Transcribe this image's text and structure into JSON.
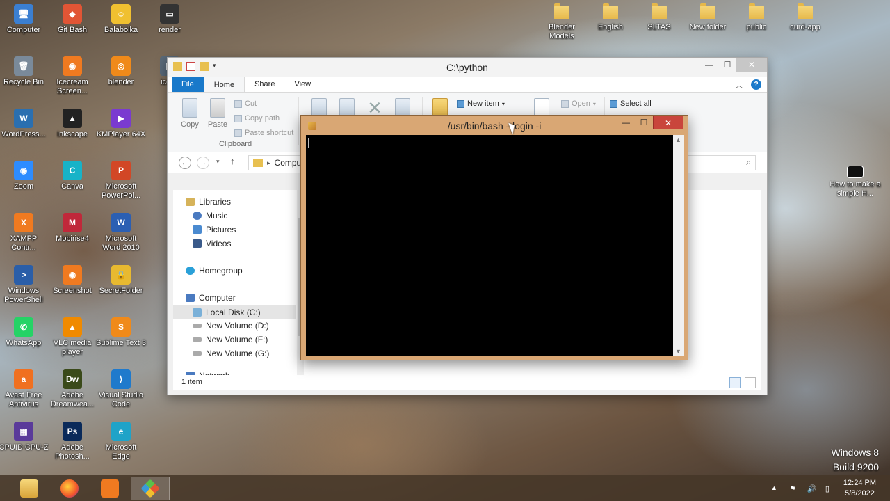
{
  "desktop": {
    "left_icons": [
      {
        "label": "Computer",
        "color": "#3b7fd1",
        "glyph": "🖥"
      },
      {
        "label": "Git Bash",
        "color": "#e15535",
        "glyph": "◆"
      },
      {
        "label": "Balabolka",
        "color": "#f0c030",
        "glyph": "☺"
      },
      {
        "label": "render",
        "color": "#333333",
        "glyph": "▭"
      },
      {
        "label": "Recycle Bin",
        "color": "#7a8a9a",
        "glyph": "🗑"
      },
      {
        "label": "Icecream Screen...",
        "color": "#f07a20",
        "glyph": "◉"
      },
      {
        "label": "blender",
        "color": "#f08a1a",
        "glyph": "◎"
      },
      {
        "label": "ice_v",
        "color": "#5a6a7a",
        "glyph": "▦"
      },
      {
        "label": "WordPress...",
        "color": "#2a6fb0",
        "glyph": "W"
      },
      {
        "label": "Inkscape",
        "color": "#222222",
        "glyph": "▲"
      },
      {
        "label": "KMPlayer 64X",
        "color": "#7a3ad0",
        "glyph": "▶"
      },
      {
        "label": "Zoom",
        "color": "#2d8cff",
        "glyph": "◉"
      },
      {
        "label": "Canva",
        "color": "#17b3c8",
        "glyph": "C"
      },
      {
        "label": "Microsoft PowerPoi...",
        "color": "#d24726",
        "glyph": "P"
      },
      {
        "label": "XAMPP Contr...",
        "color": "#f07a20",
        "glyph": "X"
      },
      {
        "label": "Mobirise4",
        "color": "#c0283a",
        "glyph": "M"
      },
      {
        "label": "Microsoft Word 2010",
        "color": "#2b5fb3",
        "glyph": "W"
      },
      {
        "label": "Windows PowerShell",
        "color": "#2a5ea8",
        "glyph": ">"
      },
      {
        "label": "Screenshot",
        "color": "#f07a20",
        "glyph": "◉"
      },
      {
        "label": "SecretFolder",
        "color": "#e8b930",
        "glyph": "🔒"
      },
      {
        "label": "WhatsApp",
        "color": "#25d366",
        "glyph": "✆"
      },
      {
        "label": "VLC media player",
        "color": "#f08a00",
        "glyph": "▲"
      },
      {
        "label": "Sublime Text 3",
        "color": "#f08a1a",
        "glyph": "S"
      },
      {
        "label": "Avast Free Antivirus",
        "color": "#f07020",
        "glyph": "a"
      },
      {
        "label": "Adobe Dreamwea...",
        "color": "#3a4a1a",
        "glyph": "Dw"
      },
      {
        "label": "Visual Studio Code",
        "color": "#1f7acc",
        "glyph": "⟩"
      },
      {
        "label": "CPUID CPU-Z",
        "color": "#5a3a9a",
        "glyph": "▦"
      },
      {
        "label": "Adobe Photosh...",
        "color": "#0a2a5a",
        "glyph": "Ps"
      },
      {
        "label": "Microsoft Edge",
        "color": "#1fa3c8",
        "glyph": "e"
      }
    ],
    "top_folders": [
      "Blender Models",
      "English",
      "SLTAS",
      "New folder",
      "public",
      "curd-app"
    ],
    "right_shortcut": {
      "label": "How to make a simple H..."
    },
    "watermark": {
      "line1": "Windows 8",
      "line2": "Build 9200"
    }
  },
  "explorer": {
    "title": "C:\\python",
    "tabs": {
      "file": "File",
      "home": "Home",
      "share": "Share",
      "view": "View"
    },
    "ribbon": {
      "copy": "Copy",
      "paste": "Paste",
      "cut": "Cut",
      "copy_path": "Copy path",
      "paste_shortcut": "Paste shortcut",
      "clipboard": "Clipboard",
      "new_item": "New item",
      "open": "Open",
      "select_all": "Select all"
    },
    "address": {
      "path": "Compute"
    },
    "nav": {
      "libraries": "Libraries",
      "music": "Music",
      "pictures": "Pictures",
      "videos": "Videos",
      "homegroup": "Homegroup",
      "computer": "Computer",
      "local_disk": "Local Disk (C:)",
      "vol_d": "New Volume (D:)",
      "vol_f": "New Volume (F:)",
      "vol_g": "New Volume (G:)",
      "network": "Network"
    },
    "status": "1 item"
  },
  "terminal": {
    "title": "/usr/bin/bash --login -i"
  },
  "taskbar": {
    "clock_time": "12:24 PM",
    "clock_date": "5/8/2022"
  },
  "colors": {
    "accent": "#1979ca",
    "terminal_frame": "#d9a774",
    "close_red": "#c9453c"
  }
}
